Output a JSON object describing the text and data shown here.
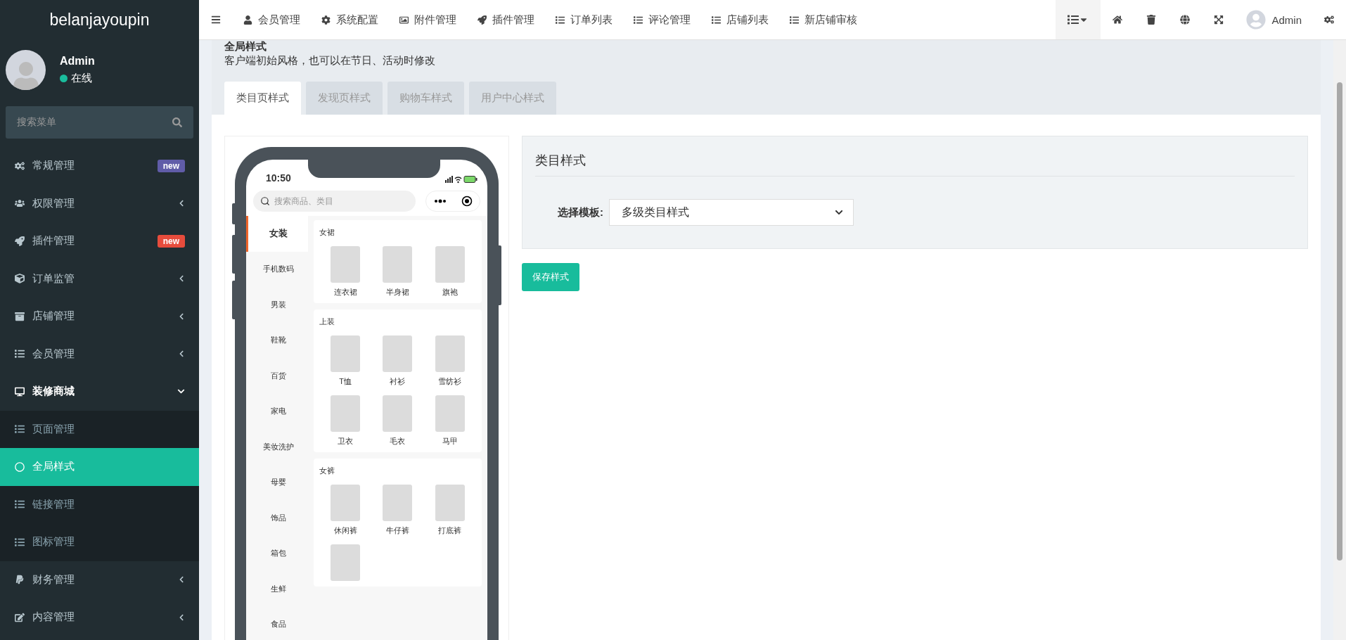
{
  "sidebar": {
    "brand": "belanjayoupin",
    "user": {
      "name": "Admin",
      "status": "在线"
    },
    "search": {
      "placeholder": "搜索菜单"
    },
    "items": [
      {
        "label": "常规管理",
        "badge": {
          "text": "new",
          "color": "#605ca8"
        }
      },
      {
        "label": "权限管理",
        "expanded": false
      },
      {
        "label": "插件管理",
        "badge": {
          "text": "new",
          "color": "#e74c3c"
        }
      },
      {
        "label": "订单监管",
        "expanded": false
      },
      {
        "label": "店铺管理",
        "expanded": false
      },
      {
        "label": "会员管理",
        "expanded": false
      },
      {
        "label": "装修商城",
        "expanded": true,
        "children": [
          {
            "label": "页面管理",
            "selected": false
          },
          {
            "label": "全局样式",
            "selected": true
          },
          {
            "label": "链接管理",
            "selected": false
          },
          {
            "label": "图标管理",
            "selected": false
          }
        ]
      },
      {
        "label": "财务管理",
        "expanded": false
      },
      {
        "label": "内容管理",
        "expanded": false
      }
    ]
  },
  "topbar": {
    "links": [
      "会员管理",
      "系统配置",
      "附件管理",
      "插件管理",
      "订单列表",
      "评论管理",
      "店铺列表",
      "新店铺审核"
    ],
    "user": "Admin"
  },
  "page": {
    "title": "全局样式",
    "subtitle": "客户端初始风格，也可以在节日、活动时修改",
    "tabs": [
      {
        "label": "类目页样式",
        "selected": true
      },
      {
        "label": "发现页样式",
        "selected": false
      },
      {
        "label": "购物车样式",
        "selected": false
      },
      {
        "label": "用户中心样式",
        "selected": false
      }
    ]
  },
  "phone": {
    "time": "10:50",
    "search": {
      "placeholder": "搜索商品、类目"
    },
    "categories": [
      {
        "label": "女装",
        "selected": true
      },
      {
        "label": "手机数码",
        "selected": false
      },
      {
        "label": "男装",
        "selected": false
      },
      {
        "label": "鞋靴",
        "selected": false
      },
      {
        "label": "百货",
        "selected": false
      },
      {
        "label": "家电",
        "selected": false
      },
      {
        "label": "美妆洗护",
        "selected": false
      },
      {
        "label": "母婴",
        "selected": false
      },
      {
        "label": "饰品",
        "selected": false
      },
      {
        "label": "箱包",
        "selected": false
      },
      {
        "label": "生鲜",
        "selected": false
      },
      {
        "label": "食品",
        "selected": false
      }
    ],
    "sections": [
      {
        "title": "女裙",
        "products": [
          {
            "kind": "captioned",
            "name": "连衣裙"
          },
          {
            "kind": "captioned",
            "name": "半身裙"
          },
          {
            "kind": "captioned",
            "name": "旗袍"
          }
        ]
      },
      {
        "title": "上装",
        "products": [
          {
            "kind": "captioned",
            "name": "T恤"
          },
          {
            "kind": "captioned",
            "name": "衬衫"
          },
          {
            "kind": "captioned",
            "name": "雪纺衫"
          },
          {
            "kind": "captioned",
            "name": "卫衣"
          },
          {
            "kind": "captioned",
            "name": "毛衣"
          },
          {
            "kind": "captioned",
            "name": "马甲"
          }
        ]
      },
      {
        "title": "女裤",
        "products": [
          {
            "kind": "captioned",
            "name": "休闲裤"
          },
          {
            "kind": "captioned",
            "name": "牛仔裤"
          },
          {
            "kind": "captioned",
            "name": "打底裤"
          },
          {
            "kind": "photo"
          }
        ]
      }
    ]
  },
  "settings": {
    "title": "类目样式",
    "template_label": "选择模板:",
    "template_value": "多级类目样式",
    "save_button": "保存样式"
  }
}
